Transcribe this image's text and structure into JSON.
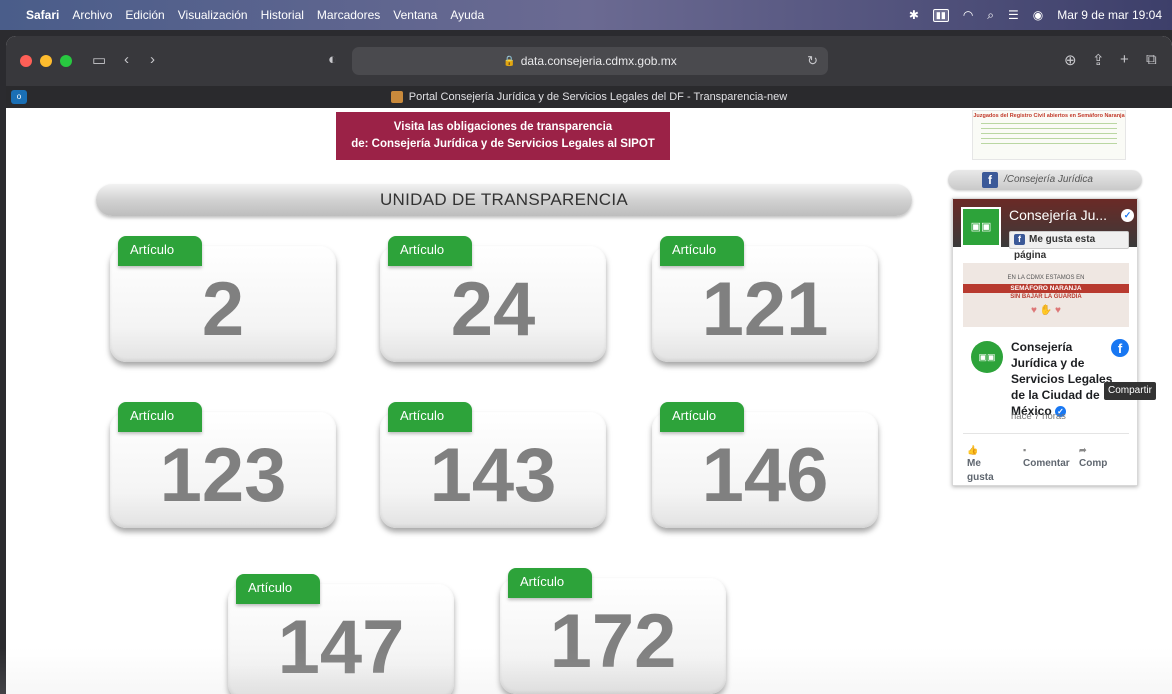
{
  "menubar": {
    "apple": "",
    "items": [
      "Safari",
      "Archivo",
      "Edición",
      "Visualización",
      "Historial",
      "Marcadores",
      "Ventana",
      "Ayuda"
    ],
    "clock": "Mar 9 de mar 19:04"
  },
  "browser": {
    "url": "data.consejeria.cdmx.gob.mx",
    "tab_title": "Portal Consejería Jurídica y de Servicios Legales del DF - Transparencia-new"
  },
  "page": {
    "sipot_banner": {
      "line1": "Visita las obligaciones de transparencia",
      "line2": "de: Consejería Jurídica y de Servicios Legales al SIPOT"
    },
    "section_title": "UNIDAD DE TRANSPARENCIA",
    "article_label": "Artículo",
    "articles": [
      "2",
      "24",
      "121",
      "123",
      "143",
      "146",
      "147",
      "172"
    ]
  },
  "sidebar": {
    "thumb_title": "Juzgados del Registro Civil abiertos en Semáforo Naranja",
    "fb_pill": "/Consejería Jurídica",
    "fb_widget": {
      "page_name": "Consejería Ju...",
      "like_button": "Me gusta esta página",
      "post_image": {
        "line1": "EN LA CDMX ESTAMOS EN",
        "line2": "SEMÁFORO NARANJA",
        "line3": "SIN BAJAR LA GUARDIA"
      },
      "post_author": "Consejería Jurídica y de Servicios Legales de la Ciudad de México",
      "post_time": "hace 7 horas",
      "actions": {
        "like": "Me gusta",
        "comment": "Comentar",
        "share": "Comp"
      }
    },
    "tooltip": "Compartir"
  }
}
